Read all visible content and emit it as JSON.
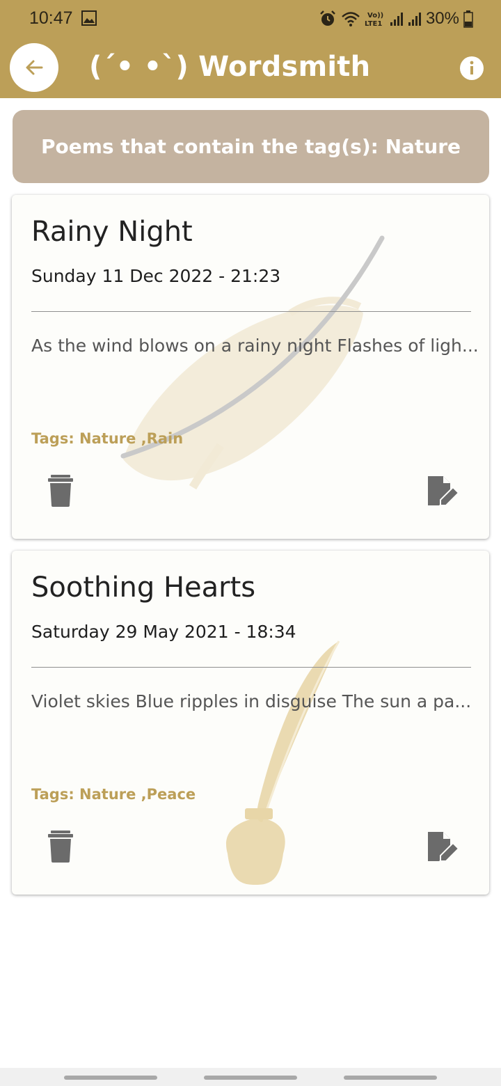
{
  "status_bar": {
    "time": "10:47",
    "battery": "30%",
    "icons": [
      "gallery-icon",
      "alarm-icon",
      "wifi-icon",
      "volte-icon",
      "signal-icon",
      "signal-icon",
      "battery-icon"
    ]
  },
  "app_bar": {
    "title": "(´• •`) Wordsmith",
    "back_icon": "arrow-left-icon",
    "info_icon": "info-icon"
  },
  "filter": {
    "label": "Poems that contain the tag(s): Nature"
  },
  "poems": [
    {
      "title": "Rainy Night",
      "date": "Sunday 11 Dec 2022 - 21:23",
      "excerpt": "As the wind blows on a rainy night Flashes of ligh...",
      "tags": "Tags: Nature ,Rain"
    },
    {
      "title": "Soothing Hearts",
      "date": "Saturday 29 May 2021 - 18:34",
      "excerpt": "Violet skies Blue ripples in disguise The sun a pa...",
      "tags": "Tags: Nature ,Peace"
    }
  ],
  "colors": {
    "primary": "#BC9F58",
    "banner": "#C4B3A0",
    "card": "#fdfdfa",
    "icon": "#6b6b6b"
  }
}
